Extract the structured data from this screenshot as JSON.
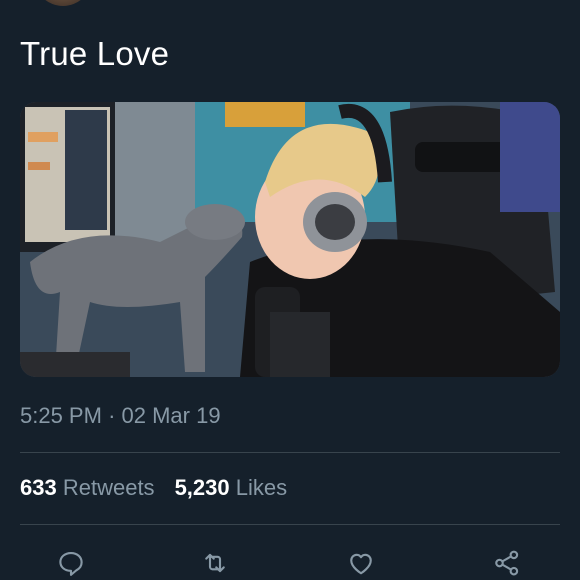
{
  "tweet": {
    "text": "True Love",
    "media_alt": "photo",
    "time": "5:25 PM",
    "separator": "·",
    "date": "02 Mar 19"
  },
  "stats": {
    "retweets_count": "633",
    "retweets_label": "Retweets",
    "likes_count": "5,230",
    "likes_label": "Likes"
  },
  "actions": {
    "icons": [
      "reply-icon",
      "retweet-icon",
      "like-icon",
      "share-icon"
    ]
  },
  "colors": {
    "background": "#15202b",
    "text_primary": "#ffffff",
    "text_secondary": "#8899a6",
    "divider": "#38444d"
  }
}
